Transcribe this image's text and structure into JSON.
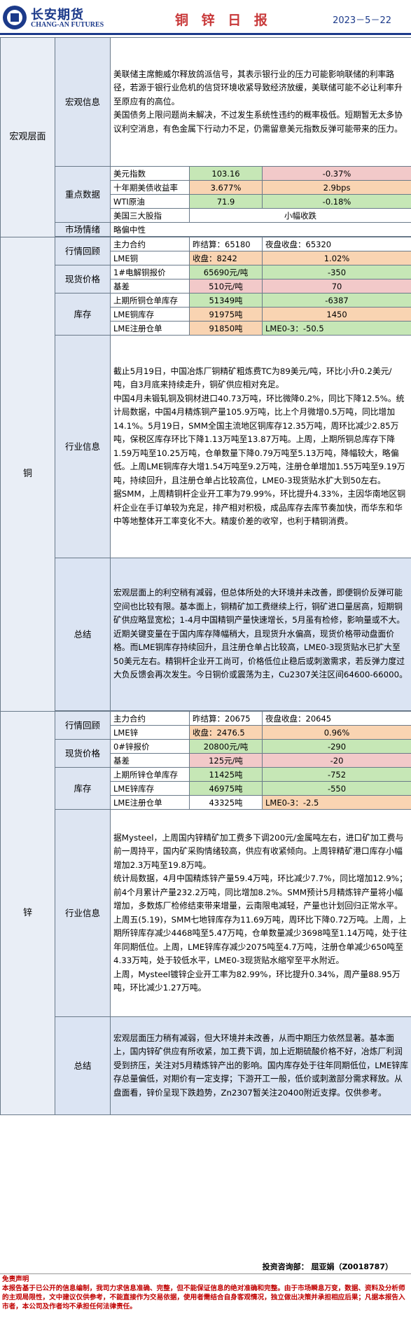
{
  "header": {
    "logo_cn": "长安期货",
    "logo_en": "CHANG-AN FUTURES",
    "title": "铜 锌 日 报",
    "date": "2023－5－22"
  },
  "macro": {
    "section": "宏观层面",
    "info_label": "宏观信息",
    "info_paragraphs": [
      "美联储主席鲍威尔释放鸽派信号，其表示银行业的压力可能影响联储的利率路径，若源于银行业危机的信贷环境收紧导致经济放缓，美联储可能不必让利率升至原应有的高位。",
      "美国债务上限问题尚未解决，不过发生系统性违约的概率极低。短期暂无太多协议利空消息，有色金属下行动力不足，仍需留意美元指数反弹可能带来的压力。"
    ],
    "key_label": "重点数据",
    "key_rows": [
      {
        "name": "美元指数",
        "value": "103.16",
        "change": "-0.37%"
      },
      {
        "name": "十年期美债收益率",
        "value": "3.677%",
        "change": "2.9bps"
      },
      {
        "name": "WTI原油",
        "value": "71.9",
        "change": "-0.18%"
      }
    ],
    "stocks_name": "美国三大股指",
    "stocks_value": "小幅收跌",
    "sentiment_label": "市场情绪",
    "sentiment_value": "略偏中性"
  },
  "copper": {
    "section": "铜",
    "review_label": "行情回顾",
    "main_contract": "主力合约",
    "prev_settle": "昨结算：65180",
    "night_close": "夜盘收盘：65320",
    "lme_name": "LME铜",
    "lme_close": "收盘：8242",
    "lme_change": "1.02%",
    "spot_label": "现货价格",
    "spot_name": "1#电解铜报价",
    "spot_price": "65690元/吨",
    "spot_change": "-350",
    "basis_name": "基差",
    "basis_value": "510元/吨",
    "basis_change": "70",
    "inv_label": "库存",
    "inv_rows": [
      {
        "name": "上期所铜仓单库存",
        "value": "51349吨",
        "change": "-6387"
      },
      {
        "name": "LME铜库存",
        "value": "91975吨",
        "change": "1450"
      },
      {
        "name": "LME注册仓单",
        "value": "91850吨",
        "change": "LME0-3：-50.5"
      }
    ],
    "industry_label": "行业信息",
    "industry_paragraphs": [
      "截止5月19日，中国冶炼厂铜精矿粗炼费TC为89美元/吨，环比小升0.2美元/吨，自3月底来持续走升，铜矿供应相对充足。",
      "中国4月未锻轧铜及铜材进口40.73万吨，环比微降0.2%，同比下降12.5%。统计局数据，中国4月精炼铜产量105.9万吨，比上个月微增0.5万吨，同比增加14.1%。5月19日，SMM全国主流地区铜库存12.35万吨，周环比减少2.85万吨，保税区库存环比下降1.13万吨至13.87万吨。上周，上期所铜总库存下降1.59万吨至10.25万吨，仓单数量下降0.79万吨至5.13万吨，降幅较大，略偏低。上周LME铜库存大增1.54万吨至9.2万吨，注册仓单增加1.55万吨至9.19万吨，持续回升，且注册仓单占比较高位，LME0-3现货贴水扩大到50左右。",
      "据SMM，上周精铜杆企业开工率为79.99%，环比提升4.33%，主因华南地区铜杆企业在手订单较为充足，排产相对积极，成品库存去库节奏加快，而华东和华中等地整体开工率变化不大。精废价差的收窄，也利于精铜消费。"
    ],
    "summary_label": "总结",
    "summary": "宏观层面上的利空稍有减弱，但总体所处的大环境并未改善，即便铜价反弹可能空间也比较有限。基本面上，铜精矿加工费继续上行，铜矿进口量居高，短期铜矿供应略显宽松；1-4月中国精铜产量快速增长，5月虽有检修，影响量或不大。近期关键变量在于国内库存降幅稍大，且现货升水偏高，现货价格带动盘面价格。而LME铜库存持续回升，且注册仓单占比较高，LME0-3现货贴水已扩大至50美元左右。精铜杆企业开工尚可，价格低位止稳后或刺激需求，若反弹力度过大负反馈会再次发生。今日铜价或震荡为主，Cu2307关注区间64600-66000。"
  },
  "zinc": {
    "section": "锌",
    "review_label": "行情回顾",
    "main_contract": "主力合约",
    "prev_settle": "昨结算：20675",
    "night_close": "夜盘收盘：20645",
    "lme_name": "LME锌",
    "lme_close": "收盘：2476.5",
    "lme_change": "0.96%",
    "spot_label": "现货价格",
    "spot_name": "0#锌报价",
    "spot_price": "20800元/吨",
    "spot_change": "-290",
    "basis_name": "基差",
    "basis_value": "125元/吨",
    "basis_change": "-20",
    "inv_label": "库存",
    "inv_rows": [
      {
        "name": "上期所锌仓单库存",
        "value": "11425吨",
        "change": "-752"
      },
      {
        "name": "LME锌库存",
        "value": "46975吨",
        "change": "-550"
      },
      {
        "name": "LME注册仓单",
        "value": "43325吨",
        "change": "LME0-3：-2.5"
      }
    ],
    "industry_label": "行业信息",
    "industry_paragraphs": [
      "据Mysteel，上周国内锌精矿加工费多下调200元/金属吨左右，进口矿加工费与前一周持平，国内矿采购情绪较高，供应有收紧倾向。上周锌精矿港口库存小幅增加2.3万吨至19.8万吨。",
      "统计局数据，4月中国精炼锌产量59.4万吨，环比减少7.7%，同比增加12.9%；前4个月累计产量232.2万吨，同比增加8.2%。SMM预计5月精炼锌产量将小幅增加，多数炼厂检修结束带来增量，云南限电减轻，产量也计划回归正常水平。上周五(5.19)，SMM七地锌库存为11.69万吨，周环比下降0.72万吨。上周，上期所锌库存减少4468吨至5.47万吨，仓单数量减少3698吨至1.14万吨，处于往年同期低位。上周，LME锌库存减少2075吨至4.7万吨，注册仓单减少650吨至4.33万吨，处于较低水平，LME0-3现货贴水缩窄至平水附近。",
      "上周，Mysteel镀锌企业开工率为82.99%，环比提升0.34%，周产量88.95万吨，环比减少1.27万吨。"
    ],
    "summary_label": "总结",
    "summary": "宏观层面压力稍有减弱，但大环境并未改善，从而中期压力依然显著。基本面上，国内锌矿供应有所收紧，加工费下调，加上近期硫酸价格不好，冶炼厂利润受到挤压，关注对5月精炼锌产出的影响。国内库存处于往年同期低位，LME锌库存总量偏低，对期价有一定支撑；下游开工一般，低价或刺激部分需求释放。从盘面看，锌价呈现下跌趋势，Zn2307暂关注20400附近支撑。仅供参考。"
  },
  "footer": {
    "analyst": "投资咨询部：  屈亚娟（Z0018787）",
    "disclaimer_title": "免责声明",
    "disclaimer": "本报告基于已公开的信息编制，我司力求信息准确、完整，但不能保证信息的绝对准确和完整。由于市场瞬息万变，数据、资料及分析师的主观局限性，文中建议仅供参考，不能直接作为交易依据，使用者需结合自身客观情况，独立做出决策并承担相应后果；凡据本报告入市者，本公司及作者均不承担任何法律责任。"
  }
}
